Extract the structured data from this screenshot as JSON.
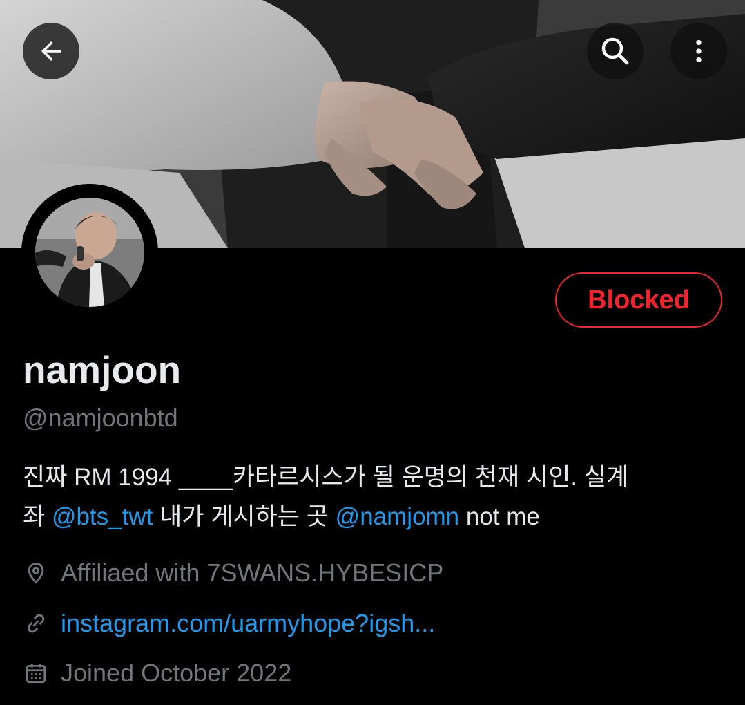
{
  "header": {
    "back_icon": "arrow-left-icon",
    "search_icon": "search-icon",
    "more_icon": "more-vertical-icon"
  },
  "profile": {
    "display_name": "namjoon",
    "handle": "@namjoonbtd",
    "action_button": "Blocked",
    "bio": {
      "line1": "진짜 RM 1994 ____카타르시스가 될 운명의 천재 시인. 실계",
      "line2_prefix": "좌 ",
      "mention1": "@bts_twt",
      "line2_middle": " 내가 게시하는 곳 ",
      "mention2": "@namjomn",
      "line2_suffix": " not me"
    },
    "location": "Affiliaed with 7SWANS.HYBESICP",
    "website": "instagram.com/uarmyhope?igsh...",
    "joined": "Joined October 2022"
  },
  "colors": {
    "background": "#000000",
    "text_primary": "#e7e9ea",
    "text_secondary": "#71767b",
    "link": "#1d9bf0",
    "blocked": "#f4212e"
  }
}
